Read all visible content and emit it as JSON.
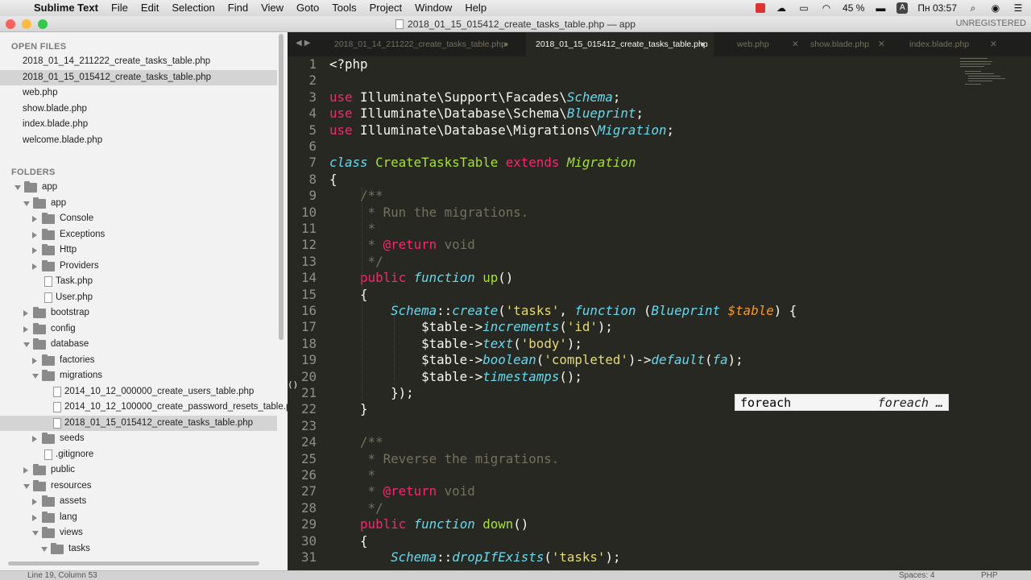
{
  "menubar": {
    "apple": "",
    "app_name": "Sublime Text",
    "items": [
      "File",
      "Edit",
      "Selection",
      "Find",
      "View",
      "Goto",
      "Tools",
      "Project",
      "Window",
      "Help"
    ],
    "battery": "45 %",
    "keyboard": "A",
    "clock": "Пн 03:57"
  },
  "window": {
    "title": "2018_01_15_015412_create_tasks_table.php — app",
    "unregistered": "UNREGISTERED"
  },
  "sidebar": {
    "open_files_header": "OPEN FILES",
    "open_files": [
      "2018_01_14_211222_create_tasks_table.php",
      "2018_01_15_015412_create_tasks_table.php",
      "web.php",
      "show.blade.php",
      "index.blade.php",
      "welcome.blade.php"
    ],
    "folders_header": "FOLDERS",
    "tree": [
      {
        "name": "app",
        "type": "folder",
        "open": true,
        "depth": 0
      },
      {
        "name": "app",
        "type": "folder",
        "open": true,
        "depth": 1
      },
      {
        "name": "Console",
        "type": "folder",
        "open": false,
        "depth": 2
      },
      {
        "name": "Exceptions",
        "type": "folder",
        "open": false,
        "depth": 2
      },
      {
        "name": "Http",
        "type": "folder",
        "open": false,
        "depth": 2
      },
      {
        "name": "Providers",
        "type": "folder",
        "open": false,
        "depth": 2
      },
      {
        "name": "Task.php",
        "type": "file",
        "depth": 2
      },
      {
        "name": "User.php",
        "type": "file",
        "depth": 2
      },
      {
        "name": "bootstrap",
        "type": "folder",
        "open": false,
        "depth": 1
      },
      {
        "name": "config",
        "type": "folder",
        "open": false,
        "depth": 1
      },
      {
        "name": "database",
        "type": "folder",
        "open": true,
        "depth": 1
      },
      {
        "name": "factories",
        "type": "folder",
        "open": false,
        "depth": 2
      },
      {
        "name": "migrations",
        "type": "folder",
        "open": true,
        "depth": 2
      },
      {
        "name": "2014_10_12_000000_create_users_table.php",
        "type": "file",
        "depth": 3
      },
      {
        "name": "2014_10_12_100000_create_password_resets_table.php",
        "type": "file",
        "depth": 3
      },
      {
        "name": "2018_01_15_015412_create_tasks_table.php",
        "type": "file",
        "depth": 3
      },
      {
        "name": "seeds",
        "type": "folder",
        "open": false,
        "depth": 2
      },
      {
        "name": ".gitignore",
        "type": "file",
        "depth": 2
      },
      {
        "name": "public",
        "type": "folder",
        "open": false,
        "depth": 1
      },
      {
        "name": "resources",
        "type": "folder",
        "open": true,
        "depth": 1
      },
      {
        "name": "assets",
        "type": "folder",
        "open": false,
        "depth": 2
      },
      {
        "name": "lang",
        "type": "folder",
        "open": false,
        "depth": 2
      },
      {
        "name": "views",
        "type": "folder",
        "open": true,
        "depth": 2
      },
      {
        "name": "tasks",
        "type": "folder",
        "open": true,
        "depth": 3
      }
    ]
  },
  "tabs": [
    {
      "label": "2018_01_14_211222_create_tasks_table.php",
      "active": false
    },
    {
      "label": "2018_01_15_015412_create_tasks_table.php",
      "active": true
    },
    {
      "label": "web.php",
      "active": false
    },
    {
      "label": "show.blade.php",
      "active": false
    },
    {
      "label": "index.blade.php",
      "active": false
    }
  ],
  "code_lines": [
    [
      [
        "<?php",
        "ds"
      ]
    ],
    [],
    [
      [
        "use",
        "k"
      ],
      [
        " Illuminate\\Support\\Facades\\",
        "ds"
      ],
      [
        "Schema",
        "icls"
      ],
      [
        ";",
        "ds"
      ]
    ],
    [
      [
        "use",
        "k"
      ],
      [
        " Illuminate\\Database\\Schema\\",
        "ds"
      ],
      [
        "Blueprint",
        "icls"
      ],
      [
        ";",
        "ds"
      ]
    ],
    [
      [
        "use",
        "k"
      ],
      [
        " Illuminate\\Database\\Migrations\\",
        "ds"
      ],
      [
        "Migration",
        "icls"
      ],
      [
        ";",
        "ds"
      ]
    ],
    [],
    [
      [
        "class",
        "sk"
      ],
      [
        " ",
        "ds"
      ],
      [
        "CreateTasksTable",
        "cls"
      ],
      [
        " ",
        "ds"
      ],
      [
        "extends",
        "k"
      ],
      [
        " ",
        "ds"
      ],
      [
        "Migration",
        "ext"
      ]
    ],
    [
      [
        "{",
        "ds"
      ]
    ],
    [
      [
        "    /**",
        "com"
      ]
    ],
    [
      [
        "     * Run the migrations.",
        "com"
      ]
    ],
    [
      [
        "     *",
        "com"
      ]
    ],
    [
      [
        "     * ",
        "com"
      ],
      [
        "@return",
        "k"
      ],
      [
        " void",
        "com"
      ]
    ],
    [
      [
        "     */",
        "com"
      ]
    ],
    [
      [
        "    ",
        "ds"
      ],
      [
        "public",
        "k"
      ],
      [
        " ",
        "ds"
      ],
      [
        "function",
        "sk"
      ],
      [
        " ",
        "ds"
      ],
      [
        "up",
        "fn"
      ],
      [
        "()",
        "ds"
      ]
    ],
    [
      [
        "    {",
        "ds"
      ]
    ],
    [
      [
        "        ",
        "ds"
      ],
      [
        "Schema",
        "icls"
      ],
      [
        "::",
        "ds"
      ],
      [
        "create",
        "icls"
      ],
      [
        "(",
        "ds"
      ],
      [
        "'tasks'",
        "str"
      ],
      [
        ", ",
        "ds"
      ],
      [
        "function",
        "sk"
      ],
      [
        " (",
        "ds"
      ],
      [
        "Blueprint",
        "icls"
      ],
      [
        " ",
        "ds"
      ],
      [
        "$table",
        "var"
      ],
      [
        ") {",
        "ds"
      ]
    ],
    [
      [
        "            $table->",
        "ds"
      ],
      [
        "increments",
        "icls"
      ],
      [
        "(",
        "ds"
      ],
      [
        "'id'",
        "str"
      ],
      [
        ");",
        "ds"
      ]
    ],
    [
      [
        "            $table->",
        "ds"
      ],
      [
        "text",
        "icls"
      ],
      [
        "(",
        "ds"
      ],
      [
        "'body'",
        "str"
      ],
      [
        ");",
        "ds"
      ]
    ],
    [
      [
        "            $table->",
        "ds"
      ],
      [
        "boolean",
        "icls"
      ],
      [
        "(",
        "ds"
      ],
      [
        "'completed'",
        "str"
      ],
      [
        ")->",
        "ds"
      ],
      [
        "default",
        "icls"
      ],
      [
        "(",
        "ds"
      ],
      [
        "fa",
        "icls"
      ],
      [
        ");",
        "ds"
      ]
    ],
    [
      [
        "            $table->",
        "ds"
      ],
      [
        "timestamps",
        "icls"
      ],
      [
        "();",
        "ds"
      ]
    ],
    [
      [
        "        });",
        "ds"
      ]
    ],
    [
      [
        "    }",
        "ds"
      ]
    ],
    [],
    [
      [
        "    /**",
        "com"
      ]
    ],
    [
      [
        "     * Reverse the migrations.",
        "com"
      ]
    ],
    [
      [
        "     *",
        "com"
      ]
    ],
    [
      [
        "     * ",
        "com"
      ],
      [
        "@return",
        "k"
      ],
      [
        " void",
        "com"
      ]
    ],
    [
      [
        "     */",
        "com"
      ]
    ],
    [
      [
        "    ",
        "ds"
      ],
      [
        "public",
        "k"
      ],
      [
        " ",
        "ds"
      ],
      [
        "function",
        "sk"
      ],
      [
        " ",
        "ds"
      ],
      [
        "down",
        "fn"
      ],
      [
        "()",
        "ds"
      ]
    ],
    [
      [
        "    {",
        "ds"
      ]
    ],
    [
      [
        "        ",
        "ds"
      ],
      [
        "Schema",
        "icls"
      ],
      [
        "::",
        "ds"
      ],
      [
        "dropIfExists",
        "icls"
      ],
      [
        "(",
        "ds"
      ],
      [
        "'tasks'",
        "str"
      ],
      [
        ");",
        "ds"
      ]
    ]
  ],
  "cursor_line_marker": "()",
  "autocomplete": {
    "trigger": "foreach",
    "hint": "foreach …"
  },
  "status": {
    "position": "Line 19, Column 53",
    "spaces": "Spaces: 4",
    "syntax": "PHP"
  },
  "colors": {
    "editor_bg": "#272822",
    "keyword": "#f92672",
    "storage": "#66d9ef",
    "entity": "#a6e22e",
    "string": "#e6db74",
    "comment": "#75715e",
    "variable": "#fd971f"
  }
}
